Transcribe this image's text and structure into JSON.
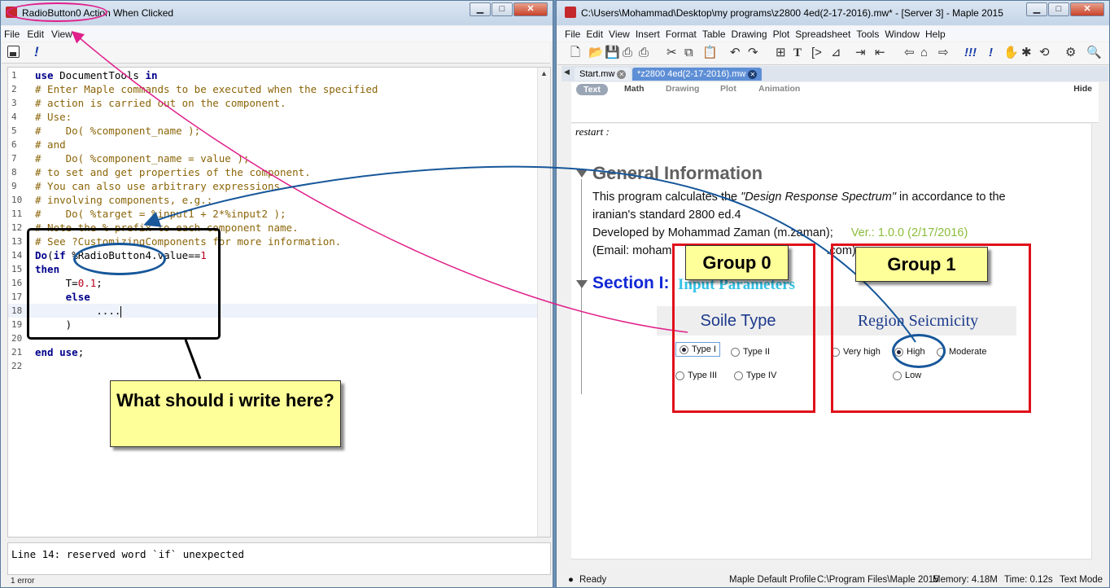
{
  "left_window": {
    "title": "RadioButton0 Action When Clicked",
    "menu": [
      "File",
      "Edit",
      "View"
    ],
    "code_lines": [
      {
        "n": "1",
        "text": "use DocumentTools in"
      },
      {
        "n": "2",
        "text": "# Enter Maple commands to be executed when the specified"
      },
      {
        "n": "3",
        "text": "# action is carried out on the component."
      },
      {
        "n": "4",
        "text": "# Use:"
      },
      {
        "n": "5",
        "text": "#    Do( %component_name );"
      },
      {
        "n": "6",
        "text": "# and"
      },
      {
        "n": "7",
        "text": "#    Do( %component_name = value );"
      },
      {
        "n": "8",
        "text": "# to set and get properties of the component."
      },
      {
        "n": "9",
        "text": "# You can also use arbitrary expressions"
      },
      {
        "n": "10",
        "text": "# involving components, e.g.:"
      },
      {
        "n": "11",
        "text": "#    Do( %target = %input1 + 2*%input2 );"
      },
      {
        "n": "12",
        "text": "# Note the % prefix to each component name."
      },
      {
        "n": "13",
        "text": "# See ?CustomizingComponents for more information."
      },
      {
        "n": "14",
        "text": "Do(if %RadioButton4.value==1"
      },
      {
        "n": "15",
        "text": "then"
      },
      {
        "n": "16",
        "text": "     T=0.1;"
      },
      {
        "n": "17",
        "text": "     else"
      },
      {
        "n": "18",
        "text": "          ...."
      },
      {
        "n": "19",
        "text": "     )"
      },
      {
        "n": "20",
        "text": ""
      },
      {
        "n": "21",
        "text": "end use;"
      },
      {
        "n": "22",
        "text": ""
      }
    ],
    "error_message": "Line 14: reserved word `if` unexpected",
    "error_count": "1 error"
  },
  "right_window": {
    "title": "C:\\Users\\Mohammad\\Desktop\\my programs\\z2800 4ed(2-17-2016).mw* - [Server 3] - Maple 2015",
    "menu": [
      "File",
      "Edit",
      "View",
      "Insert",
      "Format",
      "Table",
      "Drawing",
      "Plot",
      "Spreadsheet",
      "Tools",
      "Window",
      "Help"
    ],
    "tabs": [
      {
        "label": "Start.mw"
      },
      {
        "label": "*z2800 4ed(2-17-2016).mw"
      }
    ],
    "modes": [
      "Text",
      "Math",
      "Drawing",
      "Plot",
      "Animation"
    ],
    "hide_label": "Hide",
    "restart_cmd": "restart :",
    "general_title": "General Information",
    "general_line1_pre": "This program calculates the ",
    "general_line1_em": "\"Design Response Spectrum\"",
    "general_line1_post": " in accordance to the",
    "general_line2": "iranian's standard 2800 ed.4",
    "general_line3": "Developed by Mohammad Zaman (m.zaman);",
    "version": "Ver.: 1.0.0  (2/17/2016)",
    "email_pre": "(Email: moham",
    "email_post": ".com)",
    "section1_title": "Section I:",
    "section1_sub": "Input Parameters",
    "group0_title": "Soile Type",
    "group0_options": [
      "Type I",
      "Type II",
      "Type III",
      "Type IV"
    ],
    "group1_title": "Region Seicmicity",
    "group1_options": [
      "Very high",
      "High",
      "Moderate",
      "Low"
    ],
    "status": {
      "ready": "Ready",
      "profile": "Maple Default Profile",
      "path": "C:\\Program Files\\Maple 2015",
      "memory": "Memory: 4.18M",
      "time": "Time: 0.12s",
      "mode": "Text Mode"
    }
  },
  "annotations": {
    "group0_label": "Group 0",
    "group1_label": "Group 1",
    "question": "What should i write here?",
    "box_color": "#e0101a",
    "arrow_color": "#17579a",
    "pink_color": "#e0208a",
    "callout_color": "#ffff99"
  }
}
